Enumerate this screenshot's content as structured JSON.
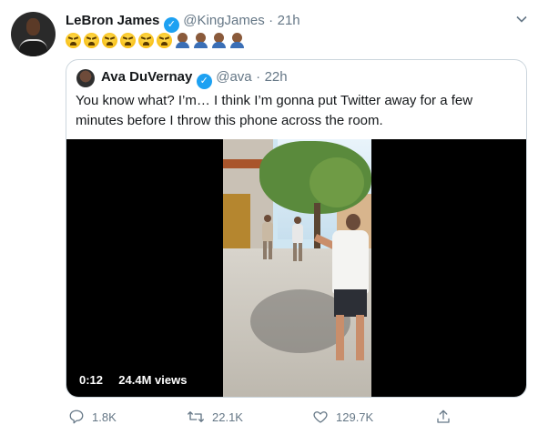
{
  "tweet": {
    "author_name": "LeBron James",
    "author_handle": "@KingJames",
    "separator": "·",
    "time": "21h",
    "emoji": [
      "angry-face",
      "angry-face",
      "angry-face",
      "angry-face",
      "angry-face",
      "angry-face",
      "facepalm",
      "facepalm",
      "facepalm",
      "facepalm"
    ],
    "accent_color": "#1da1f2"
  },
  "quoted": {
    "author_name": "Ava DuVernay",
    "author_handle": "@ava",
    "separator": "·",
    "time": "22h",
    "text": "You know what? I’m… I think I’m gonna put Twitter away for a few minutes before I throw this phone across the room.",
    "video": {
      "duration": "0:12",
      "views": "24.4M views"
    }
  },
  "actions": {
    "replies": "1.8K",
    "retweets": "22.1K",
    "likes": "129.7K"
  }
}
